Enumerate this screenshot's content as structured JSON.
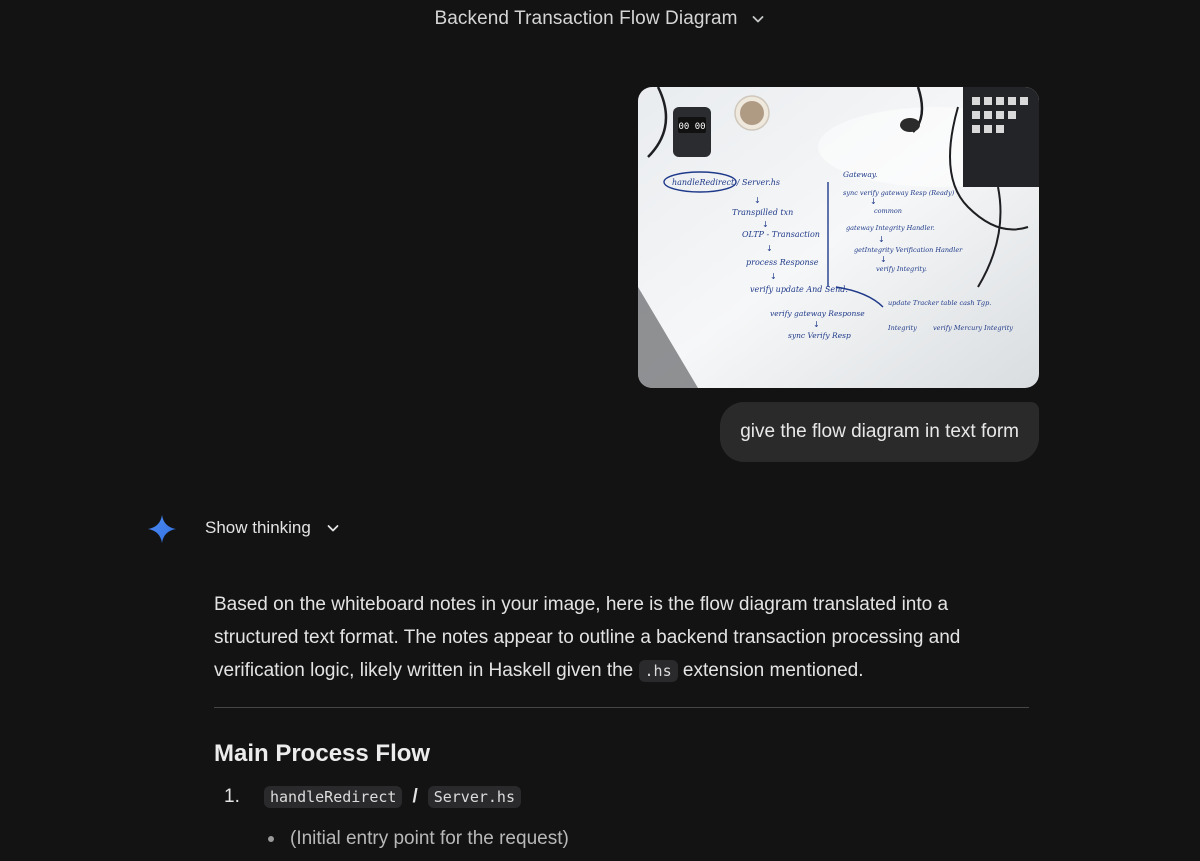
{
  "header": {
    "title": "Backend Transaction Flow Diagram",
    "dropdown_icon": "chevron-down-icon"
  },
  "user_message": {
    "text": "give the flow diagram in text form",
    "attachment_icon": "whiteboard-photo"
  },
  "whiteboard": {
    "left_column": [
      "handleRedirect / Server.hs",
      "Transpilled txn",
      "OLTP - Transaction",
      "process Response",
      "verify update And Send.",
      "verify gateway Response",
      "sync Verify Resp",
      "update Tracker table cash Tgp.",
      "Integrity",
      "verify Mercury Integrity"
    ],
    "right_column": [
      "Gateway.",
      "sync verify gateway Resp (Ready)",
      "common",
      "gateway Integrity Handler.",
      "getIntegrity Verification Handler",
      "verify Integrity."
    ]
  },
  "assistant": {
    "icon": "gemini-spark-icon",
    "show_thinking_label": "Show thinking",
    "intro_part1": "Based on the whiteboard notes in your image, here is the flow diagram translated into a structured text format. The notes appear to outline a backend transaction processing and verification logic, likely written in Haskell given the ",
    "intro_code": ".hs",
    "intro_part2": " extension mentioned.",
    "section_title": "Main Process Flow",
    "steps": [
      {
        "number": "1.",
        "code_a": "handleRedirect",
        "separator": "/",
        "code_b": "Server.hs",
        "bullet": "(Initial entry point for the request)"
      }
    ]
  },
  "colors": {
    "background": "#131314",
    "bubble": "#2a2a2b",
    "accent_blue": "#4285f4",
    "ink_blue": "#1f3a8a"
  }
}
